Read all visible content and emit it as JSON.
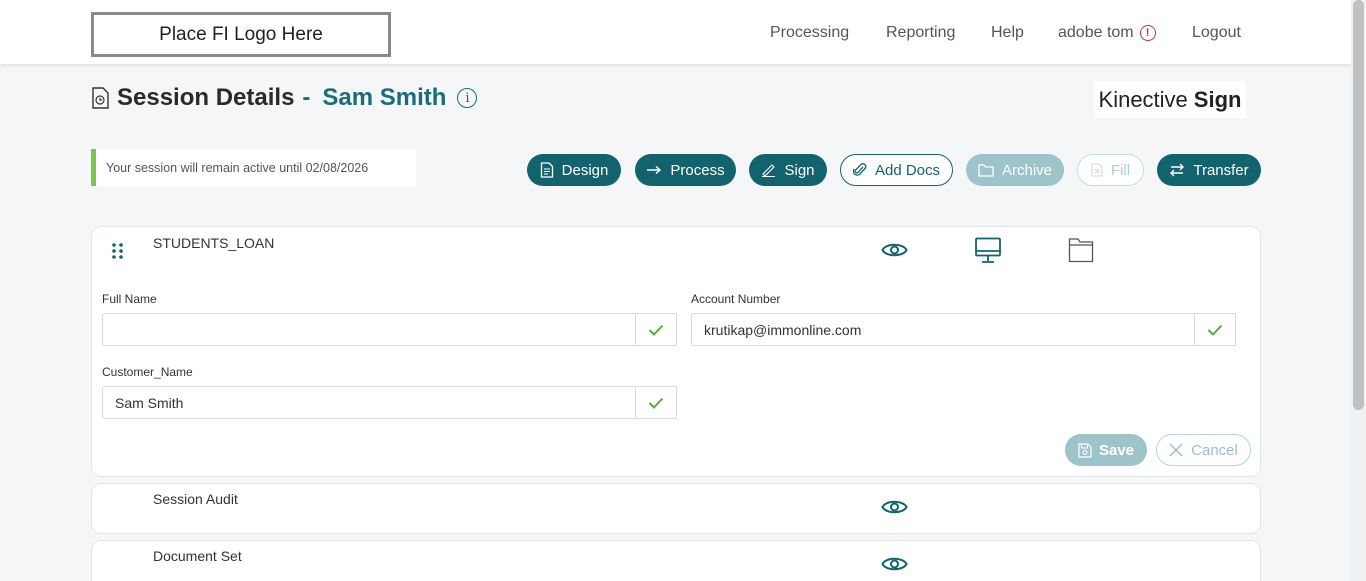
{
  "header": {
    "logo_text": "Place FI Logo Here",
    "nav": {
      "processing": "Processing",
      "reporting": "Reporting",
      "help": "Help",
      "user": "adobe tom",
      "logout": "Logout"
    }
  },
  "page": {
    "title": "Session Details",
    "separator": "-",
    "customer": "Sam Smith",
    "brand_light": "Kinective",
    "brand_bold": "Sign",
    "session_notice": "Your session will remain active until 02/08/2026"
  },
  "actions": {
    "design": "Design",
    "process": "Process",
    "sign": "Sign",
    "add_docs": "Add Docs",
    "archive": "Archive",
    "fill": "Fill",
    "transfer": "Transfer"
  },
  "document_card": {
    "title": "STUDENTS_LOAN",
    "fields": [
      {
        "label": "Full Name",
        "value": ""
      },
      {
        "label": "Account Number",
        "value": "krutikap@immonline.com"
      },
      {
        "label": "Customer_Name",
        "value": "Sam Smith"
      }
    ],
    "save_label": "Save",
    "cancel_label": "Cancel"
  },
  "other_cards": {
    "audit_title": "Session Audit",
    "docset_title": "Document Set"
  },
  "colors": {
    "primary": "#13636f",
    "accent_green": "#7cc44b",
    "alert_red": "#d0312d"
  }
}
